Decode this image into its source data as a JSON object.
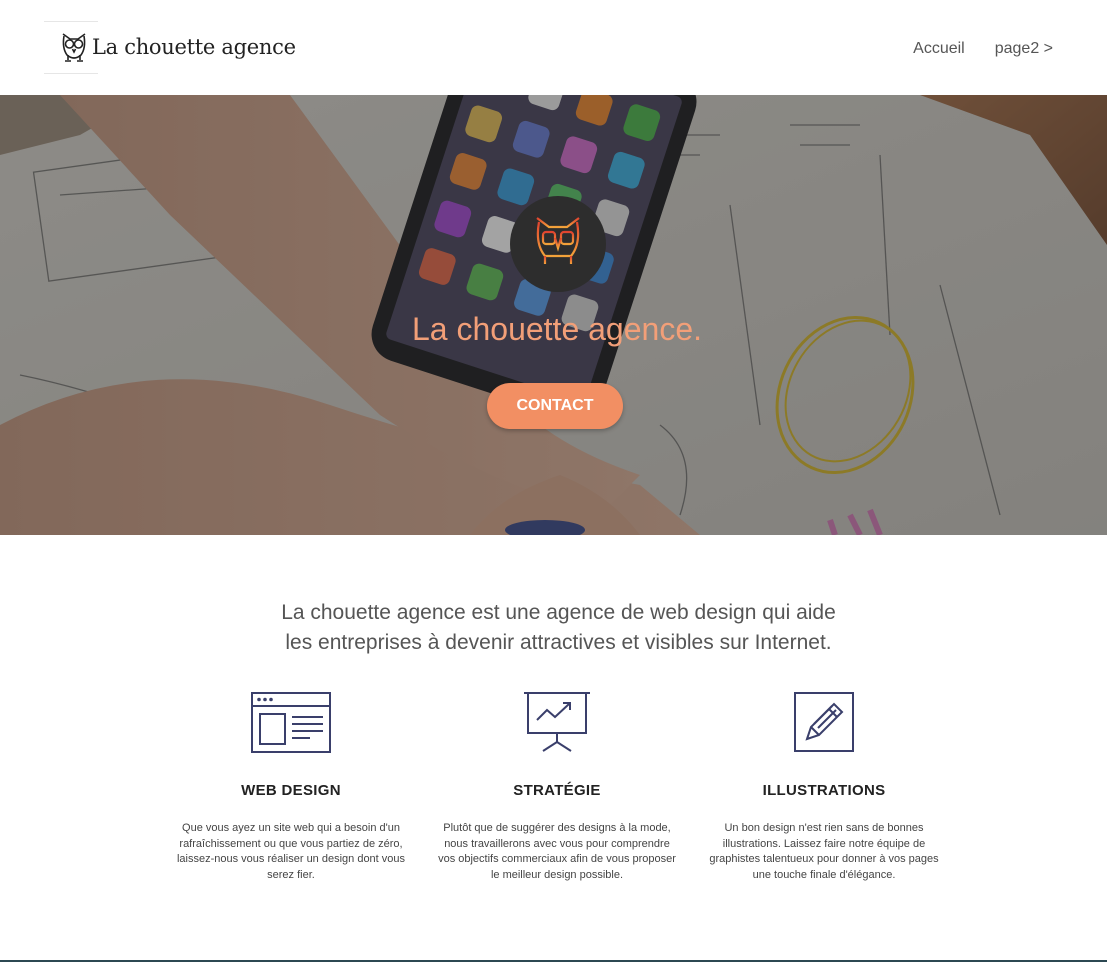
{
  "header": {
    "logo_text": "La chouette agence",
    "nav": [
      "Accueil",
      "page2 >"
    ]
  },
  "hero": {
    "title": "La chouette agence.",
    "contact_label": "CONTACT"
  },
  "intro": {
    "line1": "La chouette agence est une agence de web design qui aide",
    "line2": "les entreprises à devenir attractives et visibles sur Internet."
  },
  "services": [
    {
      "icon": "browser-window-icon",
      "title": "WEB DESIGN",
      "text": "Que vous ayez un site web qui a besoin d'un rafraîchissement ou que vous partiez de zéro, laissez-nous vous réaliser un design dont vous serez fier."
    },
    {
      "icon": "presentation-chart-icon",
      "title": "STRATÉGIE",
      "text": "Plutôt que de suggérer des designs à la mode, nous travaillerons avec vous pour comprendre vos objectifs commerciaux afin de vous proposer le meilleur design possible."
    },
    {
      "icon": "pencil-square-icon",
      "title": "ILLUSTRATIONS",
      "text": "Un bon design n'est rien sans de bonnes illustrations. Laissez faire notre équipe de graphistes talentueux pour donner à vos pages une touche finale d'élégance."
    }
  ],
  "colors": {
    "accent": "#f28f63",
    "hero_title": "#f29f78",
    "icon_stroke": "#3a3f6b"
  }
}
